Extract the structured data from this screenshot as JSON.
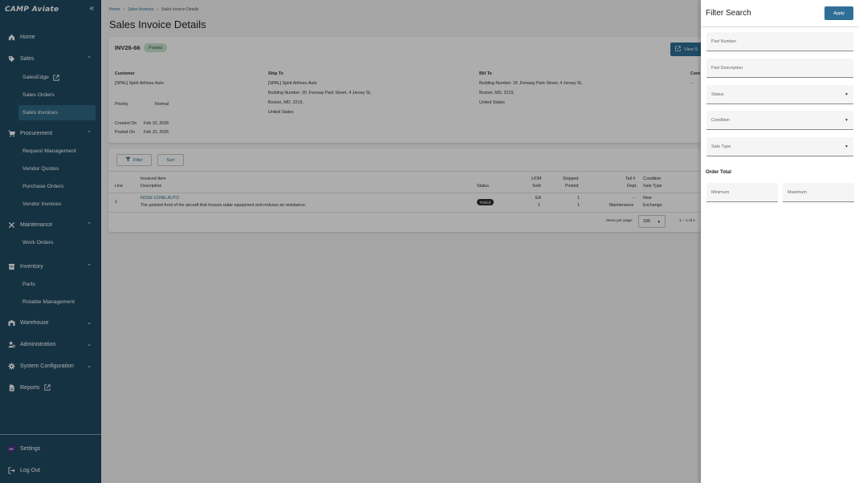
{
  "sidebar": {
    "logo": "CAMP Aviate",
    "nav": {
      "home": "Home",
      "sales": "Sales",
      "sales_edge": "SalesEdge",
      "sales_orders": "Sales Orders",
      "sales_invoices": "Sales Invoices",
      "procurement": "Procurement",
      "request_management": "Request Management",
      "vendor_quotes": "Vendor Quotes",
      "purchase_orders": "Purchase Orders",
      "vendor_invoices": "Vendor Invoices",
      "maintenance": "Maintenance",
      "work_orders": "Work Orders",
      "inventory": "Inventory",
      "parts": "Parts",
      "rotable_management": "Rotable Management",
      "warehouse": "Warehouse",
      "administration": "Administration",
      "system_configuration": "System Configuration",
      "reports": "Reports",
      "settings": "Settings",
      "log_out": "Log Out"
    },
    "avatar_initials": "DE"
  },
  "breadcrumb": [
    "Home",
    "Sales Invoices",
    "Sales Invoice Details"
  ],
  "page_title": "Sales Invoice Details",
  "invoice": {
    "number": "INV26-66",
    "status": "Posted",
    "view_button": "View S",
    "customer_label": "Customer",
    "customer": "[SPAL] Spirit Airlines-Auto",
    "ship_to_label": "Ship To",
    "ship_to": [
      "[SPAL] Spirit Airlines-Auto",
      "Building Number: 20 ,Fenway Park Street, 4 Jersey St,",
      "Boston, MD, 2215,",
      "United States"
    ],
    "bill_to_label": "Bill To",
    "bill_to": [
      "Building Number: 20 ,Fenway Park Street, 4 Jersey St,",
      "Boston, MD, 2215,",
      "United States"
    ],
    "contact_label": "Cont",
    "contact_value": "- -",
    "priority_label": "Priority",
    "priority": "Normal",
    "created_on_label": "Created On",
    "created_on": "Feb 10, 2026",
    "posted_on_label": "Posted On",
    "posted_on": "Feb 10, 2026"
  },
  "items_toolbar": {
    "filter": "Filter",
    "sort": "Sort"
  },
  "items_table": {
    "headers": {
      "line": "Line",
      "invoiced_item": "Invoiced Item",
      "description": "Description",
      "status": "Status",
      "uom": "UOM",
      "sold": "Sold",
      "shipped": "Shipped",
      "posted": "Posted",
      "tail": "Tail #",
      "dept": "Dept.",
      "condition": "Condition",
      "sale_type": "Sale Type"
    },
    "rows": [
      {
        "line": "1",
        "item": "NOSE CONE-AUTO",
        "description": "The pointed front of the aircraft that houses radar equipment and reduces air resistance.",
        "status": "Posted",
        "uom": "EA",
        "sold": "1",
        "shipped": "1",
        "posted": "1",
        "tail": "- -",
        "dept": "Maintenance",
        "condition": "New",
        "sale_type": "Exchange"
      }
    ],
    "items_per_page_label": "Items per page:",
    "items_per_page": "100",
    "range": "1 – 1 of 1"
  },
  "filter_panel": {
    "title": "Filter Search",
    "apply": "Apply",
    "part_number": "Part Number",
    "part_description": "Part Description",
    "status": "Status",
    "condition": "Condition",
    "sale_type": "Sale Type",
    "order_total_label": "Order Total",
    "minimum": "Minimum",
    "maximum": "Maximum"
  },
  "colors": {
    "sidebar_bg": "#1f4b63",
    "accent": "#2f6f96",
    "active_item": "#2f6984",
    "posted_chip": "#c9e3cf"
  }
}
